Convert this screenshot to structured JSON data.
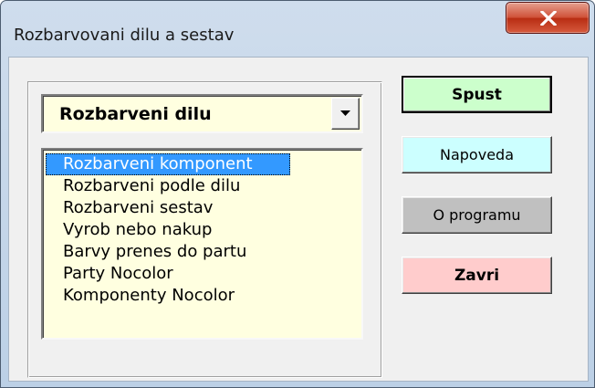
{
  "window": {
    "title": "Rozbarvovani dilu a sestav",
    "close_icon": "close-x-icon",
    "frame_color": "#bcd0e6",
    "close_color": "#c9462b"
  },
  "combo": {
    "selected_value": "Rozbarveni dilu",
    "dropdown_icon": "chevron-down-icon",
    "background": "#ffffe0"
  },
  "list": {
    "items": [
      "Rozbarveni komponent",
      "Rozbarveni podle dilu",
      "Rozbarveni sestav",
      "Vyrob nebo nakup",
      "Barvy prenes do partu",
      "Party Nocolor",
      "Komponenty Nocolor"
    ],
    "selected_index": 0,
    "selection_color": "#3399ff",
    "background": "#ffffe0"
  },
  "buttons": {
    "spust": {
      "label": "Spust",
      "color": "#ccffcc"
    },
    "napoveda": {
      "label": "Napoveda",
      "color": "#ccffff"
    },
    "o_programu": {
      "label": "O programu",
      "color": "#c0c0c0"
    },
    "zavri": {
      "label": "Zavri",
      "color": "#ffcccc"
    }
  }
}
